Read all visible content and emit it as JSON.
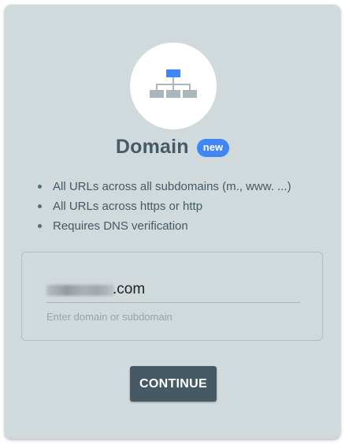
{
  "card": {
    "icon": "sitemap-icon",
    "title": "Domain",
    "badge": "new",
    "features": [
      "All URLs across all subdomains (m., www. ...)",
      "All URLs across https or http",
      "Requires DNS verification"
    ],
    "input": {
      "value": ".com",
      "placeholder": "Enter domain or subdomain"
    },
    "continue_label": "CONTINUE"
  },
  "colors": {
    "card_background": "#d0d9dc",
    "title": "#455a64",
    "badge": "#4285f4",
    "icon_accent": "#4285f4",
    "icon_gray": "#aab6bc",
    "button": "#455a64"
  }
}
